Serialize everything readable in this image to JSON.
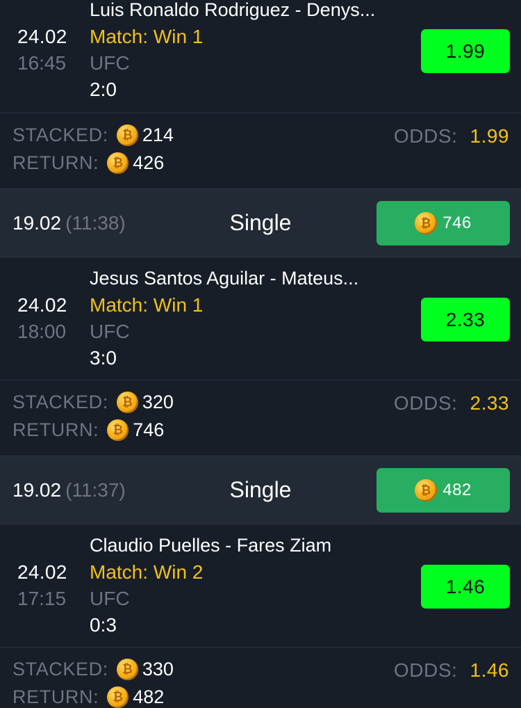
{
  "bets": [
    {
      "header": null,
      "match": {
        "date": "24.02",
        "time": "16:45",
        "teams": "Luis Ronaldo Rodriguez - Denys...",
        "market": "Match: Win 1",
        "league": "UFC",
        "score": "2:0",
        "odd": "1.99"
      },
      "summary": {
        "stacked_label": "STACKED:",
        "stacked": "214",
        "return_label": "RETURN:",
        "return": "426",
        "odds_label": "ODDS:",
        "odds": "1.99"
      }
    },
    {
      "header": {
        "date": "19.02",
        "time": "(11:38)",
        "type": "Single",
        "payout": "746"
      },
      "match": {
        "date": "24.02",
        "time": "18:00",
        "teams": "Jesus Santos Aguilar - Mateus...",
        "market": "Match: Win 1",
        "league": "UFC",
        "score": "3:0",
        "odd": "2.33"
      },
      "summary": {
        "stacked_label": "STACKED:",
        "stacked": "320",
        "return_label": "RETURN:",
        "return": "746",
        "odds_label": "ODDS:",
        "odds": "2.33"
      }
    },
    {
      "header": {
        "date": "19.02",
        "time": "(11:37)",
        "type": "Single",
        "payout": "482"
      },
      "match": {
        "date": "24.02",
        "time": "17:15",
        "teams": "Claudio Puelles - Fares Ziam",
        "market": "Match: Win 2",
        "league": "UFC",
        "score": "0:3",
        "odd": "1.46"
      },
      "summary": {
        "stacked_label": "STACKED:",
        "stacked": "330",
        "return_label": "RETURN:",
        "return": "482",
        "odds_label": "ODDS:",
        "odds": "1.46"
      }
    }
  ],
  "icons": {
    "coin": "coin-icon"
  },
  "colors": {
    "background": "#171e28",
    "header_background": "#222a35",
    "accent_yellow": "#f2c11b",
    "odd_button_green": "#00ff1f",
    "payout_button_green": "#27ae60",
    "muted_text": "#6e7580"
  }
}
